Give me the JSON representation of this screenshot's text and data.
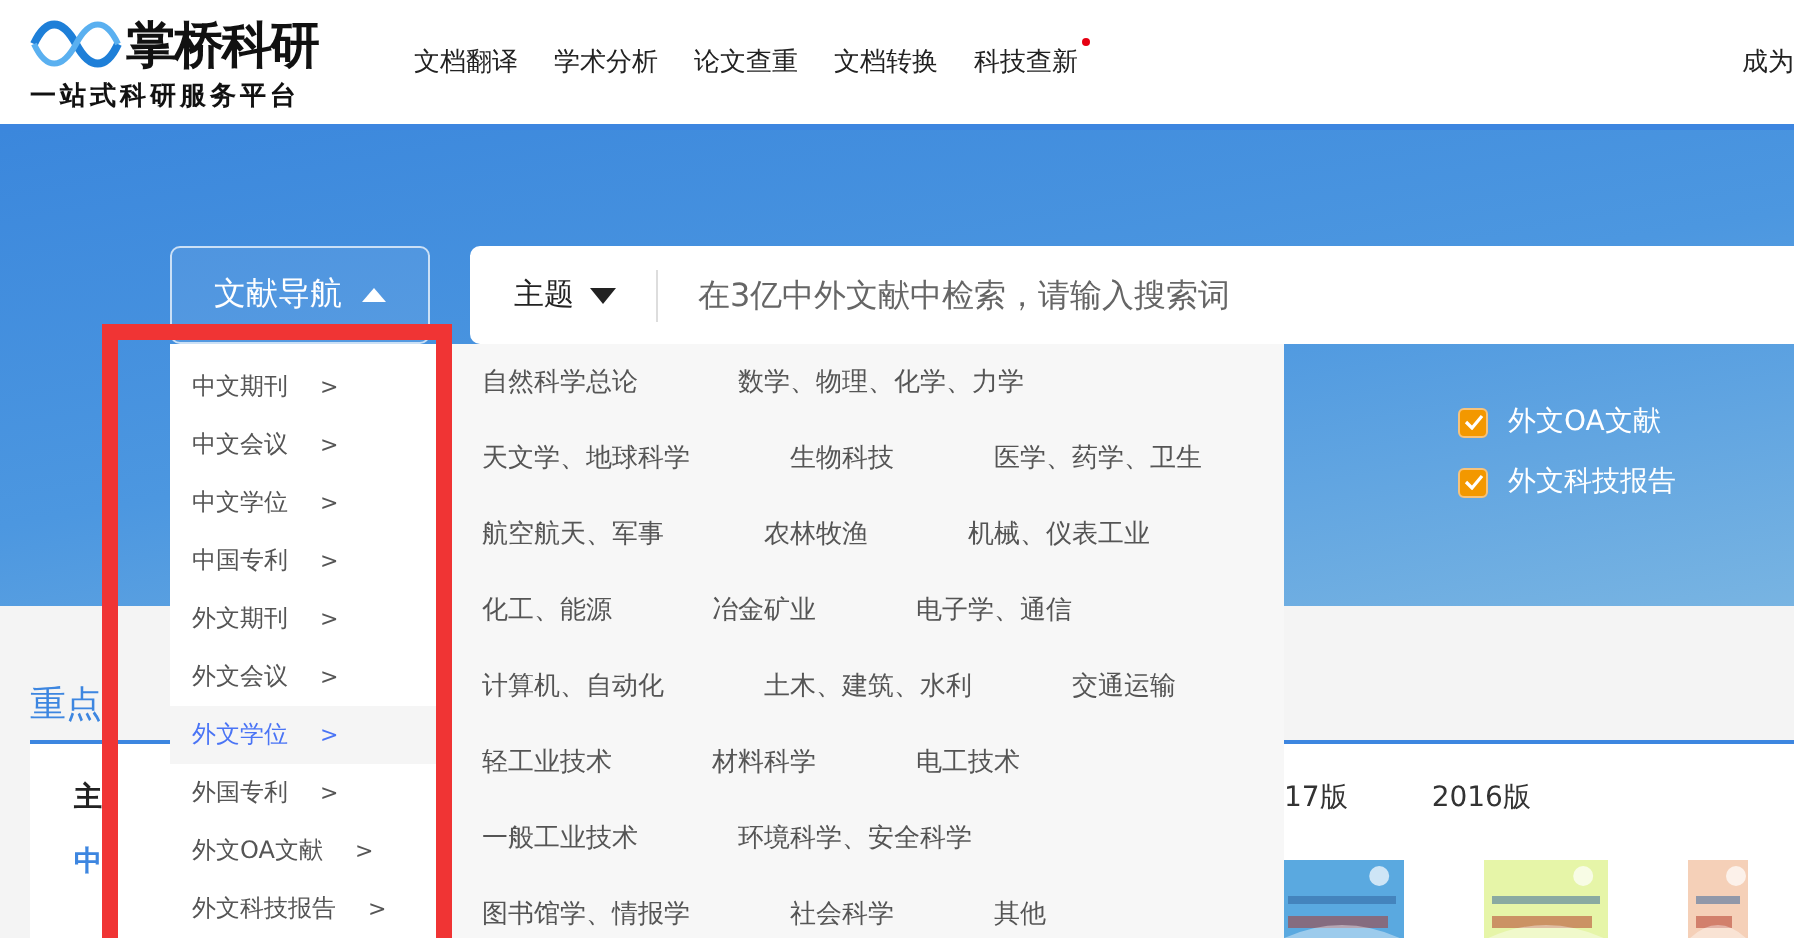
{
  "header": {
    "logo": "掌桥科研",
    "slogan": "一站式科研服务平台",
    "nav": [
      {
        "label": "文档翻译",
        "new": false
      },
      {
        "label": "学术分析",
        "new": false
      },
      {
        "label": "论文查重",
        "new": false
      },
      {
        "label": "文档转换",
        "new": false
      },
      {
        "label": "科技查新",
        "new": true
      }
    ],
    "right_link": "成为"
  },
  "hero": {
    "nav_button": "文献导航",
    "search": {
      "scope": "主题",
      "placeholder": "在3亿中外文献中检索，请输入搜索词"
    },
    "sources": [
      {
        "label": "外文OA文献",
        "checked": true
      },
      {
        "label": "外文科技报告",
        "checked": true
      }
    ]
  },
  "dropdown": {
    "arrow": ">",
    "items": [
      {
        "label": "中文期刊",
        "selected": false
      },
      {
        "label": "中文会议",
        "selected": false
      },
      {
        "label": "中文学位",
        "selected": false
      },
      {
        "label": "中国专利",
        "selected": false
      },
      {
        "label": "外文期刊",
        "selected": false
      },
      {
        "label": "外文会议",
        "selected": false
      },
      {
        "label": "外文学位",
        "selected": true
      },
      {
        "label": "外国专利",
        "selected": false
      },
      {
        "label": "外文OA文献",
        "selected": false
      },
      {
        "label": "外文科技报告",
        "selected": false
      }
    ],
    "categories": [
      [
        "自然科学总论",
        "数学、物理、化学、力学"
      ],
      [
        "天文学、地球科学",
        "生物科技",
        "医学、药学、卫生"
      ],
      [
        "航空航天、军事",
        "农林牧渔",
        "机械、仪表工业"
      ],
      [
        "化工、能源",
        "冶金矿业",
        "电子学、通信"
      ],
      [
        "计算机、自动化",
        "土木、建筑、水利",
        "交通运输"
      ],
      [
        "轻工业技术",
        "材料科学",
        "电工技术"
      ],
      [
        "一般工业技术",
        "环境科学、安全科学"
      ],
      [
        "图书馆学、情报学",
        "社会科学",
        "其他"
      ]
    ]
  },
  "journals": {
    "tab": "重点",
    "label": "主",
    "editions": [
      "17版",
      "2016版"
    ],
    "category": "中",
    "covers": [
      {
        "kind": "picture"
      },
      {
        "kind": "picture"
      },
      {
        "kind": "picture"
      }
    ]
  }
}
